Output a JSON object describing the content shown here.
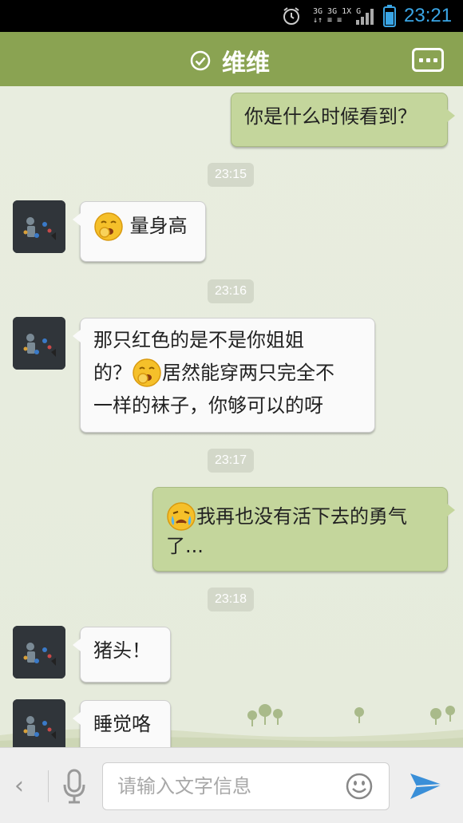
{
  "status_bar": {
    "network": [
      "3G 3G 1X G",
      "↓↑ ≡ ≡"
    ],
    "time": "23:21",
    "icons": [
      "alarm-icon",
      "signal-icon",
      "battery-icon"
    ],
    "time_color": "#3aa6e6"
  },
  "header": {
    "title": "维维",
    "icons": [
      "verified-check-icon",
      "more-menu-icon"
    ],
    "color": "#8aa352"
  },
  "messages": [
    {
      "type": "sent",
      "text": "你是什么时候看到？"
    },
    {
      "type": "timestamp",
      "text": "23:15"
    },
    {
      "type": "received",
      "emoji": "yawn-emoji",
      "text": "量身高"
    },
    {
      "type": "timestamp",
      "text": "23:16"
    },
    {
      "type": "received",
      "line1": "那只红色的是不是你姐姐",
      "line2_pre": "的？",
      "emoji": "yawn-emoji",
      "line2_post": "居然能穿两只完全不",
      "line3": "一样的袜子，你够可以的呀"
    },
    {
      "type": "timestamp",
      "text": "23:17"
    },
    {
      "type": "sent",
      "emoji": "crying-emoji",
      "line1": "我再也没有活下去的勇气",
      "line2": "了..."
    },
    {
      "type": "timestamp",
      "text": "23:18"
    },
    {
      "type": "received",
      "text": "猪头！"
    },
    {
      "type": "received",
      "text": "睡觉咯"
    }
  ],
  "input_bar": {
    "placeholder": "请输入文字信息",
    "icons": [
      "back-chevron-icon",
      "microphone-icon",
      "smiley-icon",
      "send-icon"
    ],
    "back_glyph": "‹"
  },
  "colors": {
    "sent_bubble": "#c4d69c",
    "received_bubble": "#fafafa",
    "send_icon": "#3a8fd8"
  }
}
